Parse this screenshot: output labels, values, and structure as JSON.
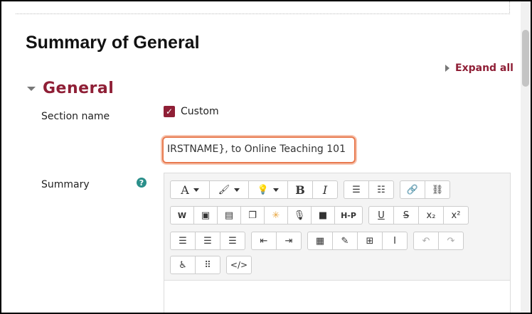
{
  "page_title": "Summary of General",
  "expand_all": "Expand all",
  "section": {
    "title": "General"
  },
  "fields": {
    "section_name_label": "Section name",
    "custom_label": "Custom",
    "section_name_value": "IRSTNAME}, to Online Teaching 101",
    "summary_label": "Summary"
  },
  "toolbar": {
    "font_glyph": "A",
    "bold": "B",
    "italic": "I",
    "h5p": "H-P",
    "underline": "U",
    "strike": "S",
    "subscript": "x₂",
    "superscript": "x²",
    "code": "</>"
  }
}
